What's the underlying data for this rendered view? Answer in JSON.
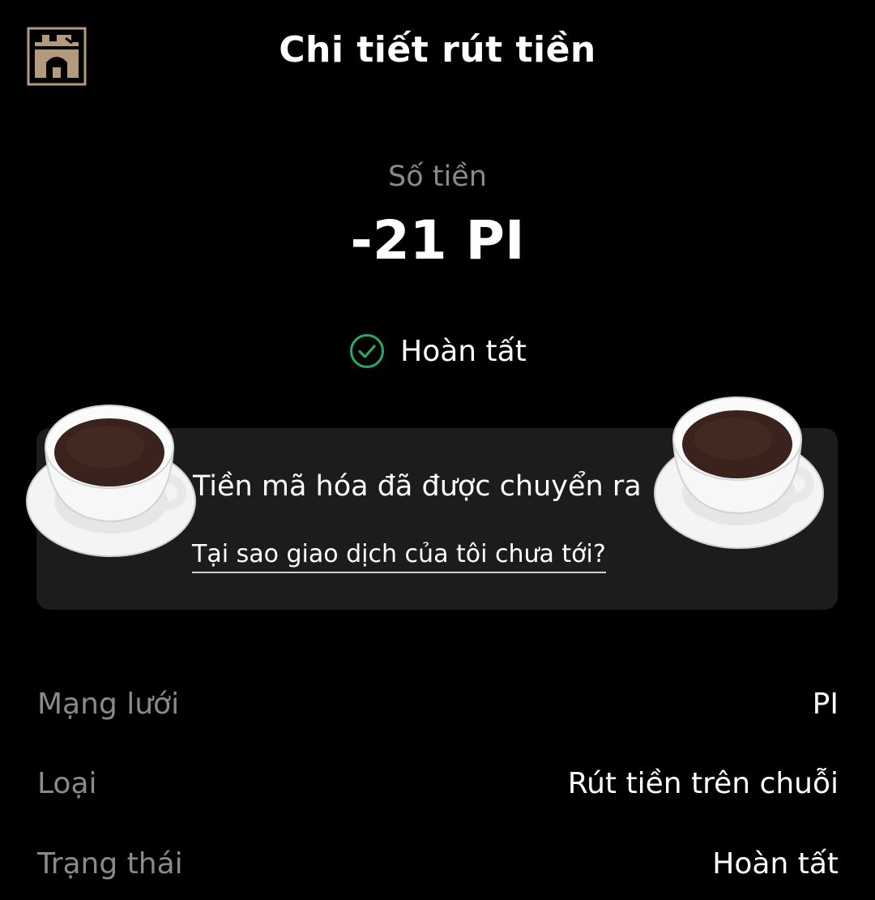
{
  "header": {
    "title": "Chi tiết rút tiền",
    "logo_icon": "castle-gate-icon"
  },
  "amount": {
    "label": "Số tiền",
    "value": "-21 PI"
  },
  "status": {
    "icon": "check-circle-icon",
    "text": "Hoàn tất",
    "color": "#2ea861"
  },
  "info_card": {
    "message": "Tiền mã hóa đã được chuyển ra",
    "link": "Tại sao giao dịch của tôi chưa tới?",
    "decoration_icon": "coffee-cup-icon"
  },
  "details": [
    {
      "label": "Mạng lưới",
      "value": "PI"
    },
    {
      "label": "Loại",
      "value": "Rút tiền trên chuỗi"
    },
    {
      "label": "Trạng thái",
      "value": "Hoàn tất"
    }
  ],
  "colors": {
    "background": "#000000",
    "card": "#1c1c1c",
    "muted_text": "#8a8a8a",
    "logo": "#b39a7c"
  }
}
